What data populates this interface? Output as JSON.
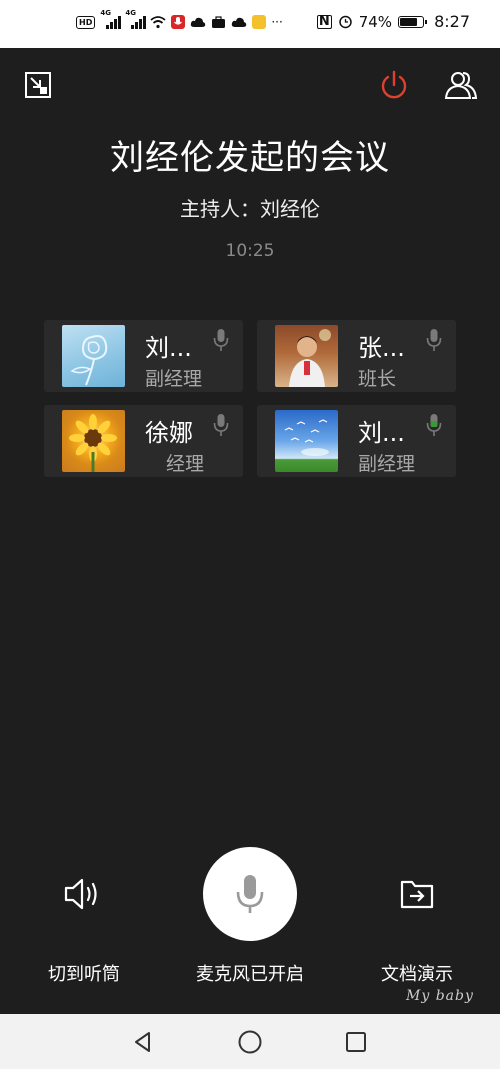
{
  "status_bar": {
    "hd_label": "HD",
    "network_left": "4G",
    "network_right": "4G",
    "more": "···",
    "battery": "74%",
    "time": "8:27"
  },
  "meeting": {
    "title": "刘经伦发起的会议",
    "host_line": "主持人：刘经伦",
    "timer": "10:25"
  },
  "participants": [
    {
      "name": "刘...",
      "role": "副经理",
      "avatar": "rose-sketch",
      "mic_color": "#7a7a7a"
    },
    {
      "name": "张...",
      "role": "班长",
      "avatar": "child-photo",
      "mic_color": "#7a7a7a"
    },
    {
      "name": "徐娜",
      "role": "经理",
      "avatar": "sunflower",
      "mic_color": "#7a7a7a"
    },
    {
      "name": "刘...",
      "role": "副经理",
      "avatar": "birds-sky",
      "mic_color": "#3a9a3a"
    }
  ],
  "controls": {
    "speaker_label": "切到听筒",
    "mic_label": "麦克风已开启",
    "doc_label": "文档演示"
  },
  "watermark": "My  baby",
  "colors": {
    "power": "#e0402f",
    "background": "#1e1e1e",
    "card": "#2a2a2a"
  }
}
